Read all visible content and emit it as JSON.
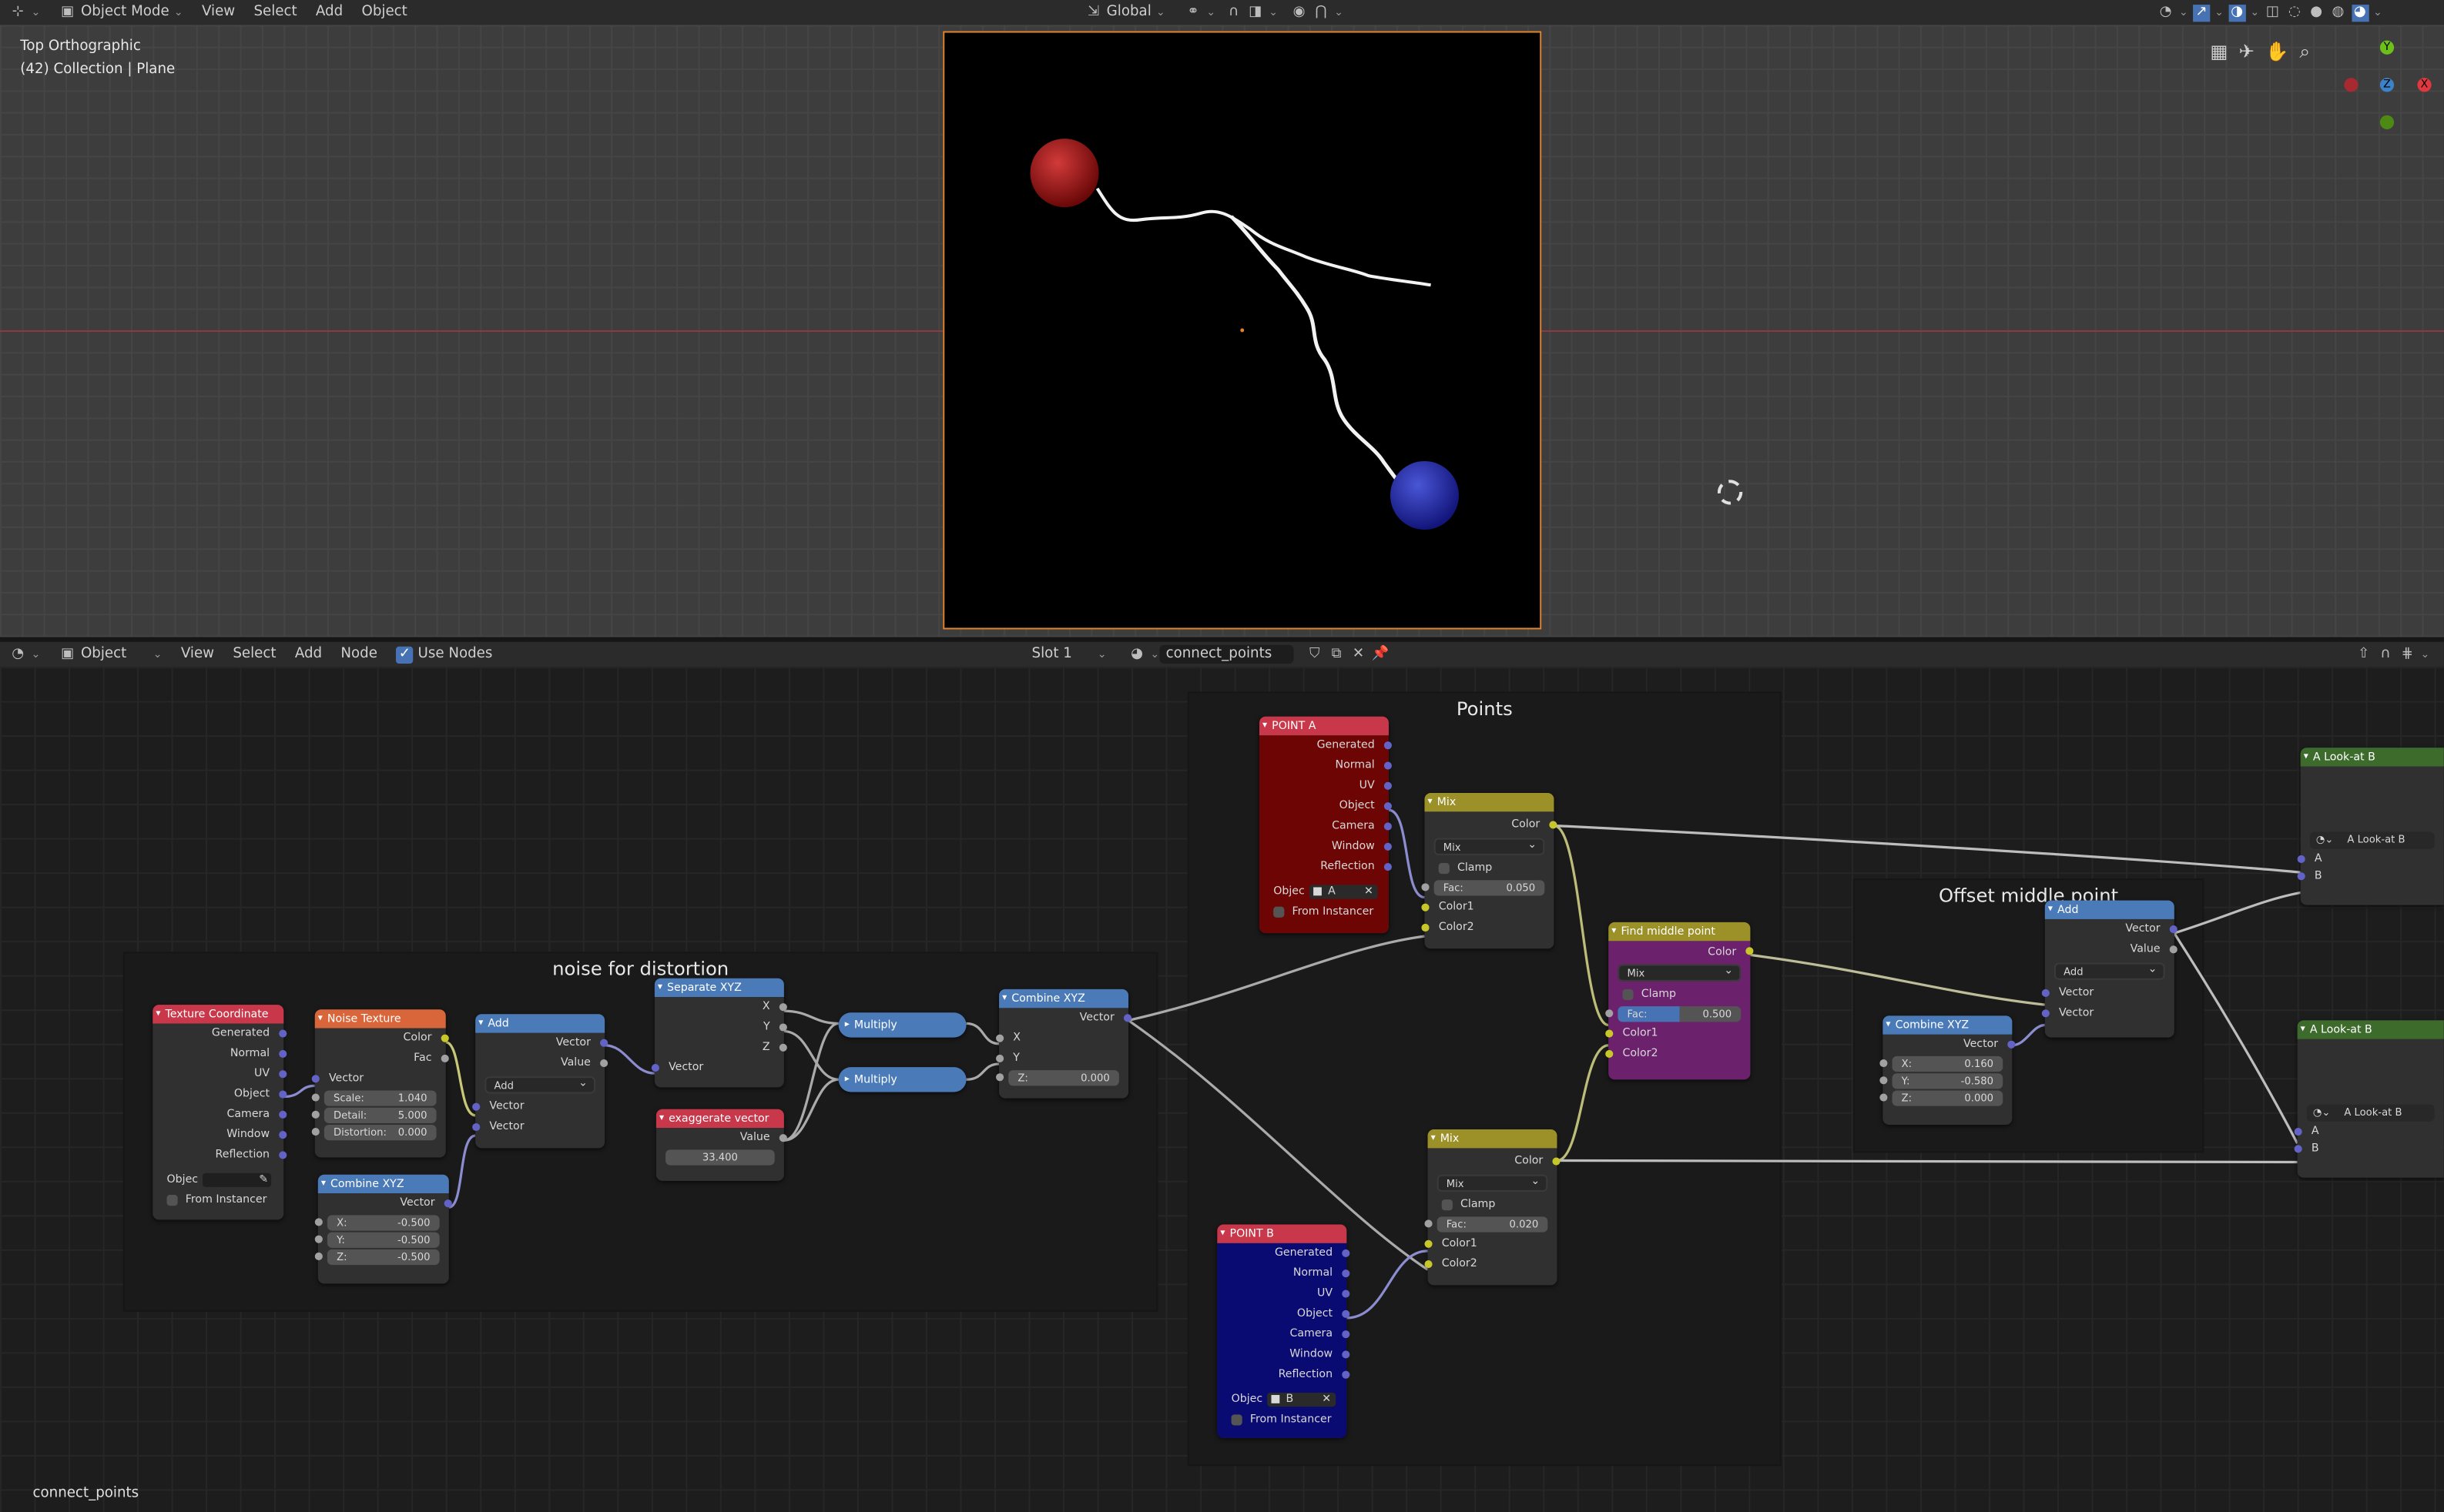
{
  "top_header": {
    "mode": "Object Mode",
    "menus": [
      "View",
      "Select",
      "Add",
      "Object"
    ],
    "transform_orientation": "Global"
  },
  "viewport": {
    "view_name": "Top Orthographic",
    "collection": "(42) Collection | Plane",
    "gizmo": {
      "y": "Y",
      "z": "Z",
      "x": "X"
    }
  },
  "node_header": {
    "type": "Object",
    "menus": [
      "View",
      "Select",
      "Add",
      "Node"
    ],
    "use_nodes_label": "Use Nodes",
    "slot": "Slot 1",
    "material": "connect_points"
  },
  "frames": {
    "noise": "noise for distortion",
    "points": "Points",
    "offset": "Offset middle point"
  },
  "nodes": {
    "texcoord": {
      "title": "Texture Coordinate",
      "outputs": [
        "Generated",
        "Normal",
        "UV",
        "Object",
        "Camera",
        "Window",
        "Reflection"
      ],
      "object_label": "Objec",
      "from_instancer": "From Instancer"
    },
    "noise": {
      "title": "Noise Texture",
      "out_color": "Color",
      "out_fac": "Fac",
      "in_vector": "Vector",
      "scale_label": "Scale:",
      "scale": "1.040",
      "detail_label": "Detail:",
      "detail": "5.000",
      "distortion_label": "Distortion:",
      "distortion": "0.000"
    },
    "add1": {
      "title": "Add",
      "out_vector": "Vector",
      "out_value": "Value",
      "op": "Add",
      "in1": "Vector",
      "in2": "Vector"
    },
    "combine1": {
      "title": "Combine XYZ",
      "out": "Vector",
      "x_label": "X:",
      "x": "-0.500",
      "y_label": "Y:",
      "y": "-0.500",
      "z_label": "Z:",
      "z": "-0.500"
    },
    "separate": {
      "title": "Separate XYZ",
      "x": "X",
      "y": "Y",
      "z": "Z",
      "in": "Vector"
    },
    "exaggerate": {
      "title": "exaggerate vector",
      "out": "Value",
      "value": "33.400"
    },
    "multiply1": {
      "title": "Multiply"
    },
    "multiply2": {
      "title": "Multiply"
    },
    "combine2": {
      "title": "Combine XYZ",
      "out": "Vector",
      "x": "X",
      "y": "Y",
      "z_label": "Z:",
      "z": "0.000"
    },
    "pointA": {
      "title": "POINT A",
      "outputs": [
        "Generated",
        "Normal",
        "UV",
        "Object",
        "Camera",
        "Window",
        "Reflection"
      ],
      "object_label": "Objec",
      "object": "A",
      "from_instancer": "From Instancer"
    },
    "pointB": {
      "title": "POINT B",
      "outputs": [
        "Generated",
        "Normal",
        "UV",
        "Object",
        "Camera",
        "Window",
        "Reflection"
      ],
      "object_label": "Objec",
      "object": "B",
      "from_instancer": "From Instancer"
    },
    "mix1": {
      "title": "Mix",
      "out": "Color",
      "op": "Mix",
      "clamp": "Clamp",
      "fac_label": "Fac:",
      "fac": "0.050",
      "c1": "Color1",
      "c2": "Color2"
    },
    "mix2": {
      "title": "Mix",
      "out": "Color",
      "op": "Mix",
      "clamp": "Clamp",
      "fac_label": "Fac:",
      "fac": "0.020",
      "c1": "Color1",
      "c2": "Color2"
    },
    "middle": {
      "title": "Find middle point",
      "out": "Color",
      "op": "Mix",
      "clamp": "Clamp",
      "fac_label": "Fac:",
      "fac": "0.500",
      "c1": "Color1",
      "c2": "Color2"
    },
    "combine3": {
      "title": "Combine XYZ",
      "out": "Vector",
      "x_label": "X:",
      "x": "0.160",
      "y_label": "Y:",
      "y": "-0.580",
      "z_label": "Z:",
      "z": "0.000"
    },
    "add2": {
      "title": "Add",
      "out_vector": "Vector",
      "out_value": "Value",
      "op": "Add",
      "in1": "Vector",
      "in2": "Vector"
    },
    "lookat1": {
      "title": "A Look-at B",
      "group": "A Look-at B",
      "a": "A",
      "b": "B"
    },
    "lookat2": {
      "title": "A Look-at B",
      "group": "A Look-at B",
      "a": "A",
      "b": "B"
    }
  },
  "status_material": "connect_points",
  "colors": {
    "input_header": "#c8384a",
    "texture_header": "#d8663a",
    "vector_header": "#4a7bb8",
    "color_header": "#9c9028",
    "group_header": "#3d6b2c",
    "vector_socket": "#6363c7",
    "color_socket": "#c7c729",
    "float_socket": "#a1a1a1"
  }
}
